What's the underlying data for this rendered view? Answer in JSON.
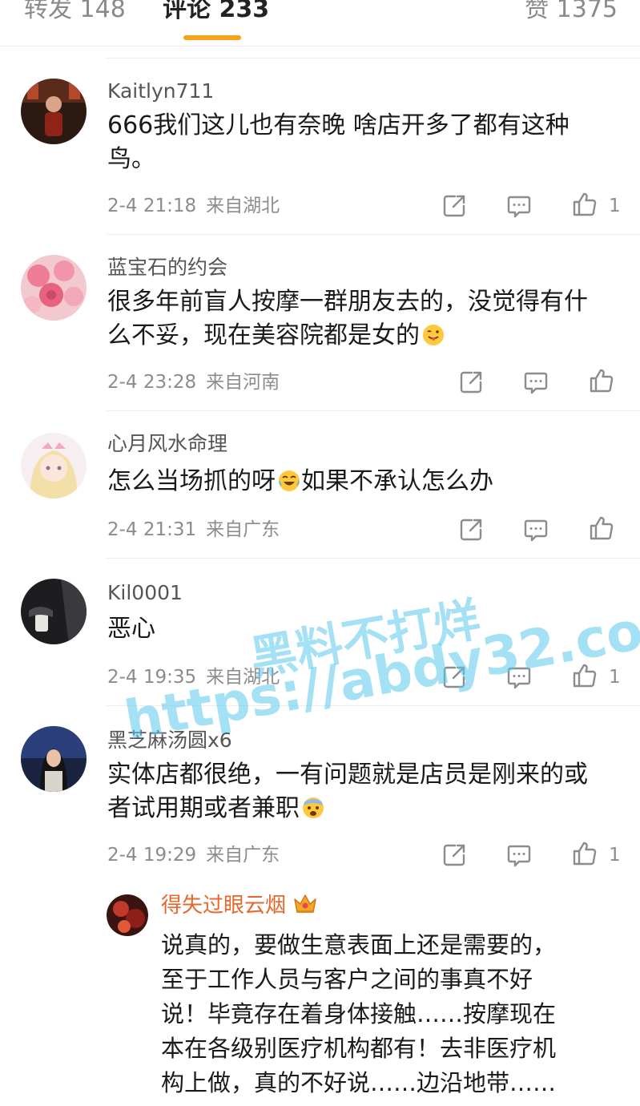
{
  "tabs": {
    "repost": "转发 148",
    "comments": "评论 233",
    "likes": "赞 1375"
  },
  "comments": [
    {
      "username": "Kaitlyn711",
      "text": "666我们这儿也有奈晚 啥店开多了都有这种鸟。",
      "time": "2-4 21:18",
      "location": "来自湖北",
      "likes": "1"
    },
    {
      "username": "蓝宝石的约会",
      "text": "很多年前盲人按摩一群朋友去的，没觉得有什么不妥，现在美容院都是女的",
      "emoji": "tongue-out-emoji",
      "time": "2-4 23:28",
      "location": "来自河南",
      "likes": ""
    },
    {
      "username": "心月风水命理",
      "text_before": "怎么当场抓的呀",
      "emoji": "crying-laughing-emoji",
      "text_after": "如果不承认怎么办",
      "time": "2-4 21:31",
      "location": "来自广东",
      "likes": ""
    },
    {
      "username": "Kil0001",
      "text": "恶心",
      "time": "2-4 19:35",
      "location": "来自湖北",
      "likes": "1"
    },
    {
      "username": "黑芝麻汤圆x6",
      "text": "实体店都很绝，一有问题就是店员是刚来的或者试用期或者兼职",
      "emoji": "fearful-emoji",
      "time": "2-4 19:29",
      "location": "来自广东",
      "likes": "1"
    }
  ],
  "reply": {
    "username": "得失过眼云烟",
    "badge_icon": "crown-icon",
    "lines": [
      "说真的，要做生意表面上还是需要的，",
      "至于工作人员与客户之间的事真不好",
      "说！毕竟存在着身体接触……按摩现在",
      "本在各级别医疗机构都有！去非医疗机",
      "构上做，真的不好说……边沿地带……"
    ]
  },
  "watermark": {
    "line1": "黑料不打烊",
    "line2": "https://abdy32.com"
  },
  "colors": {
    "accent_underline": "#f7a21b",
    "reply_name": "#e5672c",
    "watermark": "#5ac8eb"
  }
}
